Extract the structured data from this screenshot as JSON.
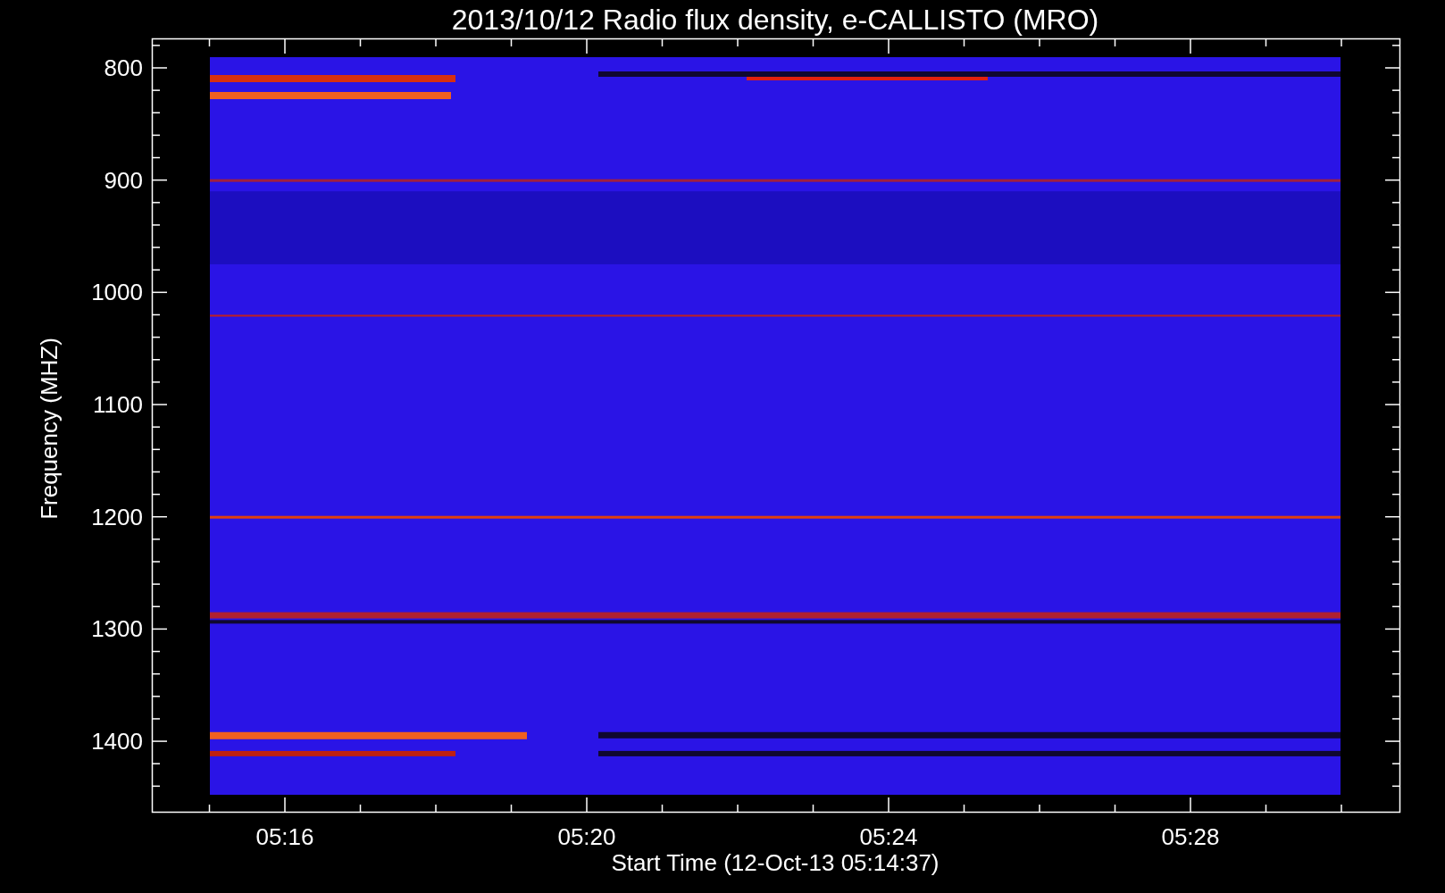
{
  "title": "2013/10/12  Radio flux density, e-CALLISTO (MRO)",
  "ylabel": "Frequency (MHZ)",
  "xlabel": "Start Time (12-Oct-13 05:14:37)",
  "y_ticks": [
    "800",
    "900",
    "1000",
    "1100",
    "1200",
    "1300",
    "1400"
  ],
  "x_ticks": [
    "05:16",
    "05:20",
    "05:24",
    "05:28"
  ]
}
